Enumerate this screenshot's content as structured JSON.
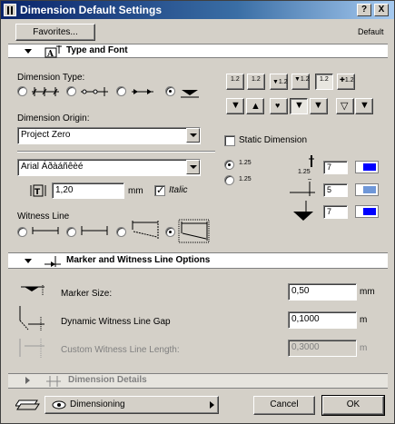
{
  "window": {
    "title": "Dimension Default Settings",
    "help_label": "?",
    "close_label": "X"
  },
  "top": {
    "favorites_label": "Favorites...",
    "default_label": "Default"
  },
  "type_font": {
    "section_title": "Type and Font",
    "dimension_type_label": "Dimension Type:",
    "dimension_type_selected_index": 3,
    "dimension_origin_label": "Dimension Origin:",
    "origin_value": "Project Zero",
    "static_dimension_label": "Static Dimension",
    "static_dimension_checked": false,
    "font_value": "Arial Áðàáñêèé",
    "font_size_value": "1,20",
    "font_size_unit": "mm",
    "italic_label": "Italic",
    "italic_checked": true,
    "witness_line_label": "Witness Line",
    "witness_selected_index": 3,
    "text_pos_value_1": "1.25",
    "text_pos_value_2": "1.25",
    "pen_label_top": "1.25",
    "pen_value_1": "7",
    "pen_value_2": "5",
    "pen_value_3": "7",
    "pen_colors": [
      "#0000ff",
      "#6f97d8",
      "#0000ff"
    ],
    "text_radio_selected": 0
  },
  "marker": {
    "section_title": "Marker and Witness Line Options",
    "marker_size_label": "Marker Size:",
    "marker_size_value": "0,50",
    "marker_size_unit": "mm",
    "gap_label": "Dynamic Witness Line Gap",
    "gap_value": "0,1000",
    "gap_unit": "m",
    "custom_length_label": "Custom Witness Line Length:",
    "custom_length_value": "0,3000",
    "custom_length_unit": "m"
  },
  "details": {
    "section_title": "Dimension Details"
  },
  "footer": {
    "layer_value": "Dimensioning",
    "cancel_label": "Cancel",
    "ok_label": "OK"
  }
}
